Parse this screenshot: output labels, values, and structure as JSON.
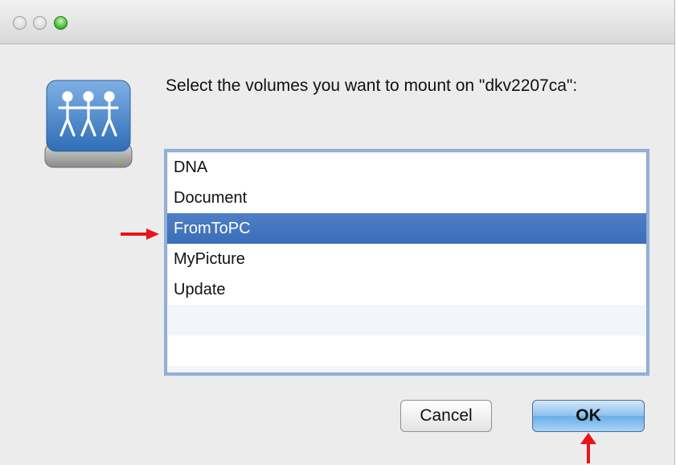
{
  "dialog": {
    "prompt": "Select the volumes you want to mount on \"dkv2207ca\":",
    "volumes": [
      "DNA",
      "Document",
      "FromToPC",
      "MyPicture",
      "Update"
    ],
    "selected": "FromToPC"
  },
  "buttons": {
    "cancel_label": "Cancel",
    "ok_label": "OK"
  },
  "colors": {
    "selection": "#3b6db8",
    "annotation_arrow": "#e8141c"
  },
  "icons": {
    "app_icon": "network-shared-drive-icon",
    "annotation_right": "red-arrow-right-icon",
    "annotation_up": "red-arrow-up-icon"
  }
}
